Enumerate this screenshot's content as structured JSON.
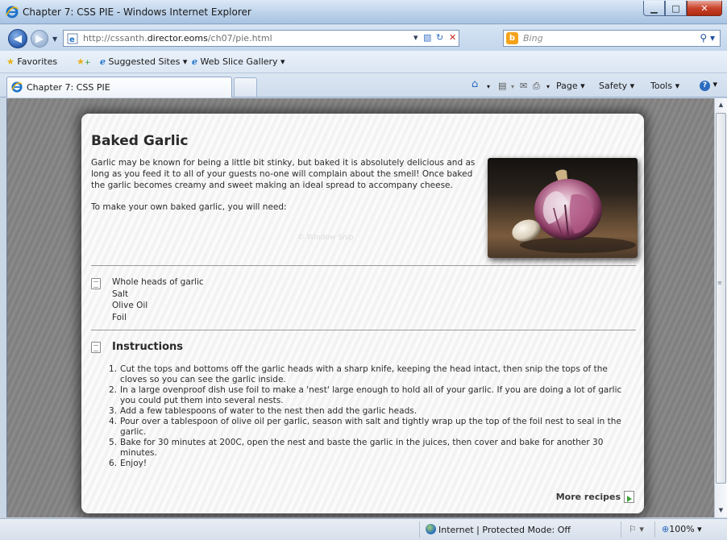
{
  "window": {
    "title": "Chapter 7: CSS PIE - Windows Internet Explorer",
    "min_icon": "minimize-icon",
    "max_icon": "maximize-icon",
    "close_icon": "close-icon"
  },
  "address": {
    "url_prefix": "http://cssanth.",
    "url_host": "director.eoms",
    "url_path": "/ch07/pie.html",
    "search_placeholder": "Bing"
  },
  "favorites": {
    "favorites_label": "Favorites",
    "suggested_label": "Suggested Sites ▾",
    "webslice_label": "Web Slice Gallery ▾"
  },
  "tab": {
    "label": "Chapter 7: CSS PIE"
  },
  "commands": {
    "page": "Page ▾",
    "safety": "Safety ▾",
    "tools": "Tools ▾"
  },
  "article": {
    "title": "Baked Garlic",
    "intro": "Garlic may be known for being a little bit stinky, but baked it is absolutely delicious and as long as you feed it to all of your guests no-one will complain about the smell! Once baked the garlic becomes creamy and sweet making an ideal spread to accompany cheese.",
    "need": "To make your own baked garlic, you will need:",
    "watermark": "©   Window Snip",
    "ingredients": [
      "Whole heads of garlic",
      "Salt",
      "Olive Oil",
      "Foil"
    ],
    "instructions_title": "Instructions",
    "steps": [
      "Cut the tops and bottoms off the garlic heads with a sharp knife, keeping the head intact, then snip the tops of the cloves so you can see the garlic inside.",
      "In a large ovenproof dish use foil to make a 'nest' large enough to hold all of your garlic. If you are doing a lot of garlic you could put them into several nests.",
      "Add a few tablespoons of water to the nest then add the garlic heads.",
      "Pour over a tablespoon of olive oil per garlic, season with salt and tightly wrap up the top of the foil nest to seal in the garlic.",
      "Bake for 30 minutes at 200C, open the nest and baste the garlic in the juices, then cover and bake for another 30 minutes.",
      "Enjoy!"
    ],
    "more_label": "More recipes"
  },
  "status": {
    "zone": "Internet | Protected Mode: Off",
    "zoom": "100%"
  }
}
